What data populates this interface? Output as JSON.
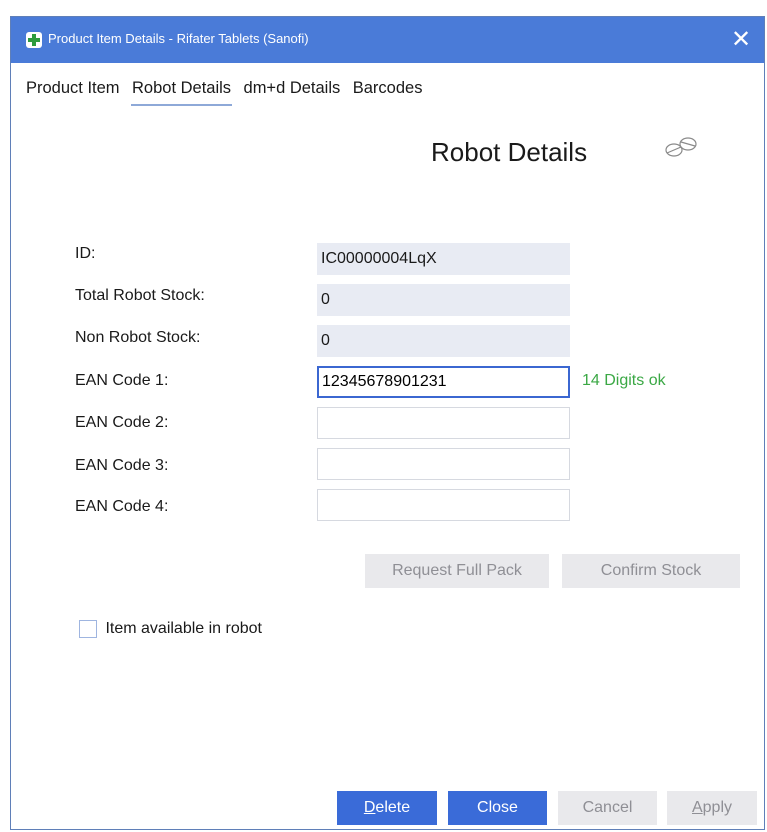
{
  "window": {
    "title": "Product Item Details - Rifater Tablets (Sanofi)",
    "close_glyph": "✕"
  },
  "tabs": [
    {
      "label": "Product Item",
      "active": false
    },
    {
      "label": "Robot Details",
      "active": true
    },
    {
      "label": "dm+d Details",
      "active": false
    },
    {
      "label": "Barcodes",
      "active": false
    }
  ],
  "section": {
    "heading": "Robot Details",
    "icon": "pills-icon"
  },
  "form": {
    "id": {
      "label": "ID:",
      "value": "IC00000004LqX"
    },
    "total_robot_stock": {
      "label": "Total Robot Stock:",
      "value": "0"
    },
    "non_robot_stock": {
      "label": "Non Robot Stock:",
      "value": "0"
    },
    "ean1": {
      "label": "EAN Code 1:",
      "value": "12345678901231",
      "hint": "14 Digits ok"
    },
    "ean2": {
      "label": "EAN Code 2:",
      "value": ""
    },
    "ean3": {
      "label": "EAN Code 3:",
      "value": ""
    },
    "ean4": {
      "label": "EAN Code 4:",
      "value": ""
    }
  },
  "actions": {
    "request_full_pack": "Request Full Pack",
    "confirm_stock": "Confirm Stock"
  },
  "checkbox": {
    "label": "Item available in robot",
    "checked": false
  },
  "footer": {
    "delete": {
      "accel": "D",
      "rest": "elete"
    },
    "close": "Close",
    "cancel": "Cancel",
    "apply": {
      "accel": "A",
      "rest": "pply"
    }
  },
  "colors": {
    "titlebar": "#4a7bd8",
    "primary_button": "#3a6bd8",
    "disabled_button": "#e9e9ec",
    "readonly_field": "#e8ebf3",
    "ok_hint": "#3ba845",
    "focus_border": "#3b67d1"
  }
}
